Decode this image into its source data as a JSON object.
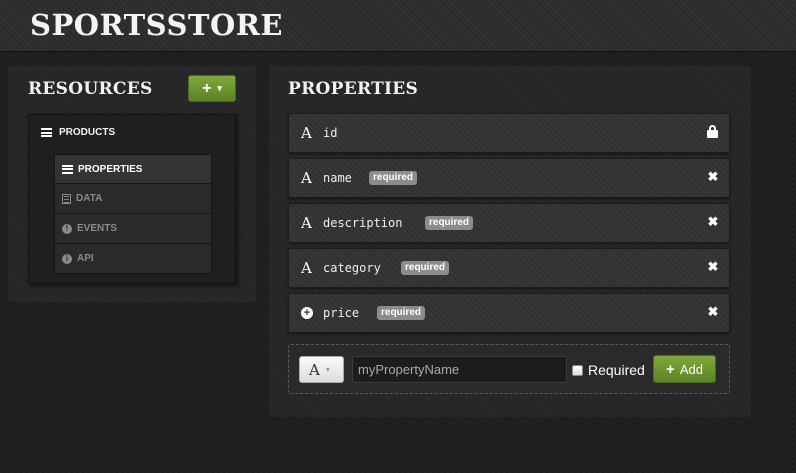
{
  "app": {
    "brand": "SPORTSSTORE"
  },
  "resources": {
    "title": "RESOURCES",
    "add_button_icon": "+",
    "add_button_caret": "▾",
    "tree_root": "PRODUCTS",
    "items": [
      {
        "label": "PROPERTIES",
        "icon": "list-icon",
        "active": true
      },
      {
        "label": "DATA",
        "icon": "data-icon",
        "active": false
      },
      {
        "label": "EVENTS",
        "icon": "exclamation-icon",
        "active": false
      },
      {
        "label": "API",
        "icon": "info-icon",
        "active": false
      }
    ]
  },
  "properties": {
    "title": "PROPERTIES",
    "rows": [
      {
        "type_glyph": "A",
        "name": "id",
        "badge": "",
        "action": "lock-icon"
      },
      {
        "type_glyph": "A",
        "name": "name",
        "badge": "required",
        "action": "close-icon"
      },
      {
        "type_glyph": "A",
        "name": "description",
        "badge": "required",
        "action": "close-icon"
      },
      {
        "type_glyph": "A",
        "name": "category",
        "badge": "required",
        "action": "close-icon"
      },
      {
        "type_glyph": "+",
        "name": "price",
        "badge": "required",
        "action": "close-icon"
      }
    ],
    "new_property": {
      "type_glyph": "A",
      "type_caret": "▾",
      "name_placeholder": "myPropertyName",
      "name_value": "",
      "required_label": "Required",
      "required_checked": false,
      "add_label": "Add",
      "add_icon": "+"
    },
    "close_glyph": "✖"
  },
  "colors": {
    "accent_green": "#6a9531",
    "badge_gray": "#8c8c8c",
    "panel_bg": "#262626"
  }
}
